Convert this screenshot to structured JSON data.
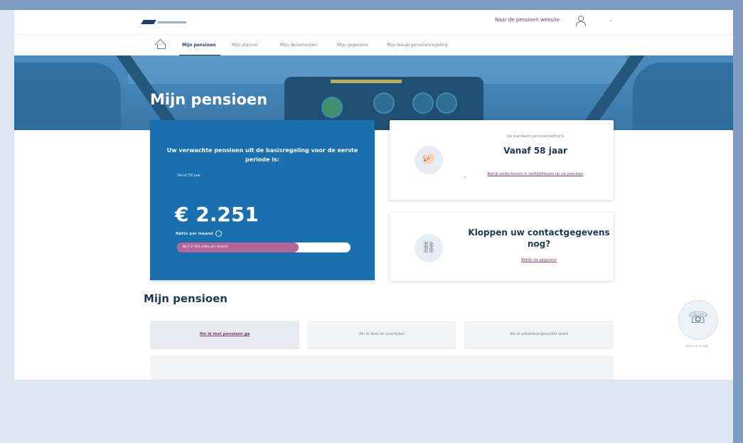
{
  "header": {
    "top_link": "Naar de pensioen website",
    "user_icon": "user-icon",
    "chevron": "⌄"
  },
  "nav": {
    "home_icon": "home-icon",
    "items": [
      {
        "label": "Mijn pensioen",
        "active": true
      },
      {
        "label": "Mijn planner",
        "active": false
      },
      {
        "label": "Mijn documenten",
        "active": false
      },
      {
        "label": "Mijn gegevens",
        "active": false
      },
      {
        "label": "Mijn leeuw pensioenregeling",
        "active": false
      }
    ]
  },
  "hero": {
    "title": "Mijn pensioen"
  },
  "pension_card": {
    "headline": "Uw verwachte pensioen uit de basisregeling voor de eerste periode is:",
    "sub": "Vanaf 58 jaar",
    "amount": "€ 2.251",
    "per_month": "Netto per maand",
    "progress_label": "Bij € 2.500 netto per maand",
    "progress_fraction": 0.7
  },
  "cards": {
    "pension_age": {
      "small": "Uw standaard pensioenleeftijd is",
      "big": "Vanaf 58 jaar",
      "link": "Bekijk welke keuzes in leeftijd/keuzes op uw pensioen",
      "icon": "piggy-bank-icon"
    },
    "contact": {
      "big": "Kloppen uw contactgegevens nog?",
      "link": "Bekijk uw gegevens",
      "icon": "link-chain-icon"
    }
  },
  "section": {
    "title": "Mijn pensioen",
    "tabs": [
      {
        "label": "Als ik met pensioen ga",
        "active": true
      },
      {
        "label": "Als ik kom te overlijden",
        "active": false
      },
      {
        "label": "Als ik arbeidsongeschikt word",
        "active": false
      }
    ]
  },
  "contact_widget": {
    "label": "Stel uw vraag",
    "icon": "chat-support-icon"
  },
  "colors": {
    "primary_blue": "#1a6fae",
    "accent_purple": "#b4669a",
    "navy_text": "#1f3a55",
    "frame": "#7d9bc0"
  }
}
